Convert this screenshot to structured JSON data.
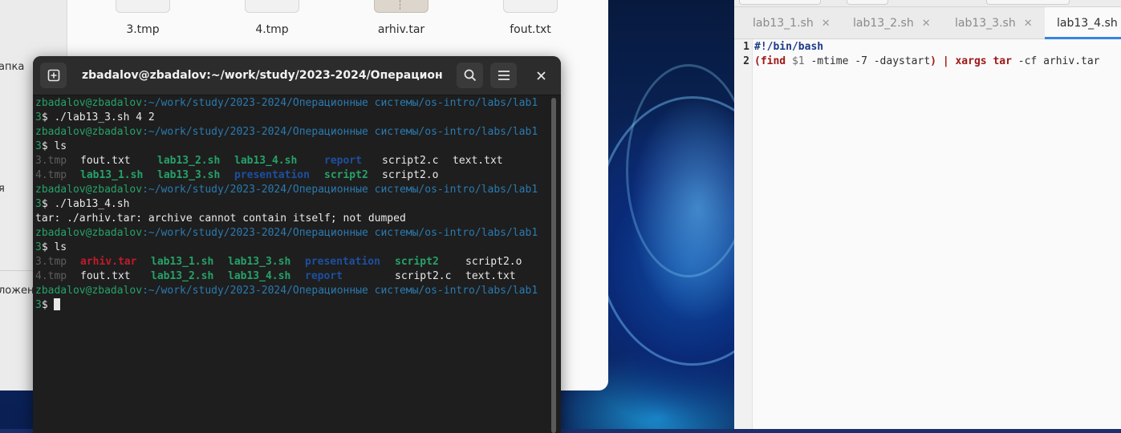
{
  "file_manager": {
    "sidebar_labels": [
      "апка",
      "я",
      "ложен"
    ],
    "files": [
      {
        "name": "3.tmp",
        "kind": "text"
      },
      {
        "name": "4.tmp",
        "kind": "text"
      },
      {
        "name": "arhiv.tar",
        "kind": "archive"
      },
      {
        "name": "fout.txt",
        "kind": "text"
      }
    ]
  },
  "terminal": {
    "title": "zbadalov@zbadalov:~/work/study/2023-2024/Операционные ...",
    "prompt_user": "zbadalov@zbadalov",
    "prompt_path": ":~/work/study/2023-2024/Операционные системы/os-intro/labs/lab1",
    "prompt_cont": "3",
    "commands": [
      "$ ./lab13_3.sh 4 2",
      "$ ls",
      "$ ./lab13_4.sh",
      "$ ls",
      "$ "
    ],
    "ls1": {
      "row1": [
        "3.tmp",
        "fout.txt",
        "lab13_2.sh",
        "lab13_4.sh",
        "report",
        "script2.c",
        "text.txt"
      ],
      "row2": [
        "4.tmp",
        "lab13_1.sh",
        "lab13_3.sh",
        "presentation",
        "script2",
        "script2.o"
      ]
    },
    "error_line": "tar: ./arhiv.tar: archive cannot contain itself; not dumped",
    "ls2": {
      "row1": [
        "3.tmp",
        "arhiv.tar",
        "lab13_1.sh",
        "lab13_3.sh",
        "presentation",
        "script2",
        "script2.o"
      ],
      "row2": [
        "4.tmp",
        "fout.txt",
        "lab13_2.sh",
        "lab13_4.sh",
        "report",
        "script2.c",
        "text.txt"
      ]
    }
  },
  "editor": {
    "tabs": [
      "lab13_1.sh",
      "lab13_2.sh",
      "lab13_3.sh",
      "lab13_4.sh"
    ],
    "active_tab": 3,
    "lines": [
      {
        "n": "1",
        "parts": {
          "shebang": "#!/bin/bash"
        }
      },
      {
        "n": "2",
        "parts": {
          "p1": "(find",
          "p2": " $1",
          "p3": " -mtime -7 -daystart",
          "p4": ") | xargs",
          "p5": " tar",
          "p6": " -cf arhiv.tar"
        }
      }
    ]
  },
  "colors": {
    "terminal_bg": "#1e1e1e",
    "prompt_green": "#26a269",
    "directory_blue": "#1d4fa0",
    "archive_red": "#c01c28",
    "accent": "#3584e4"
  }
}
